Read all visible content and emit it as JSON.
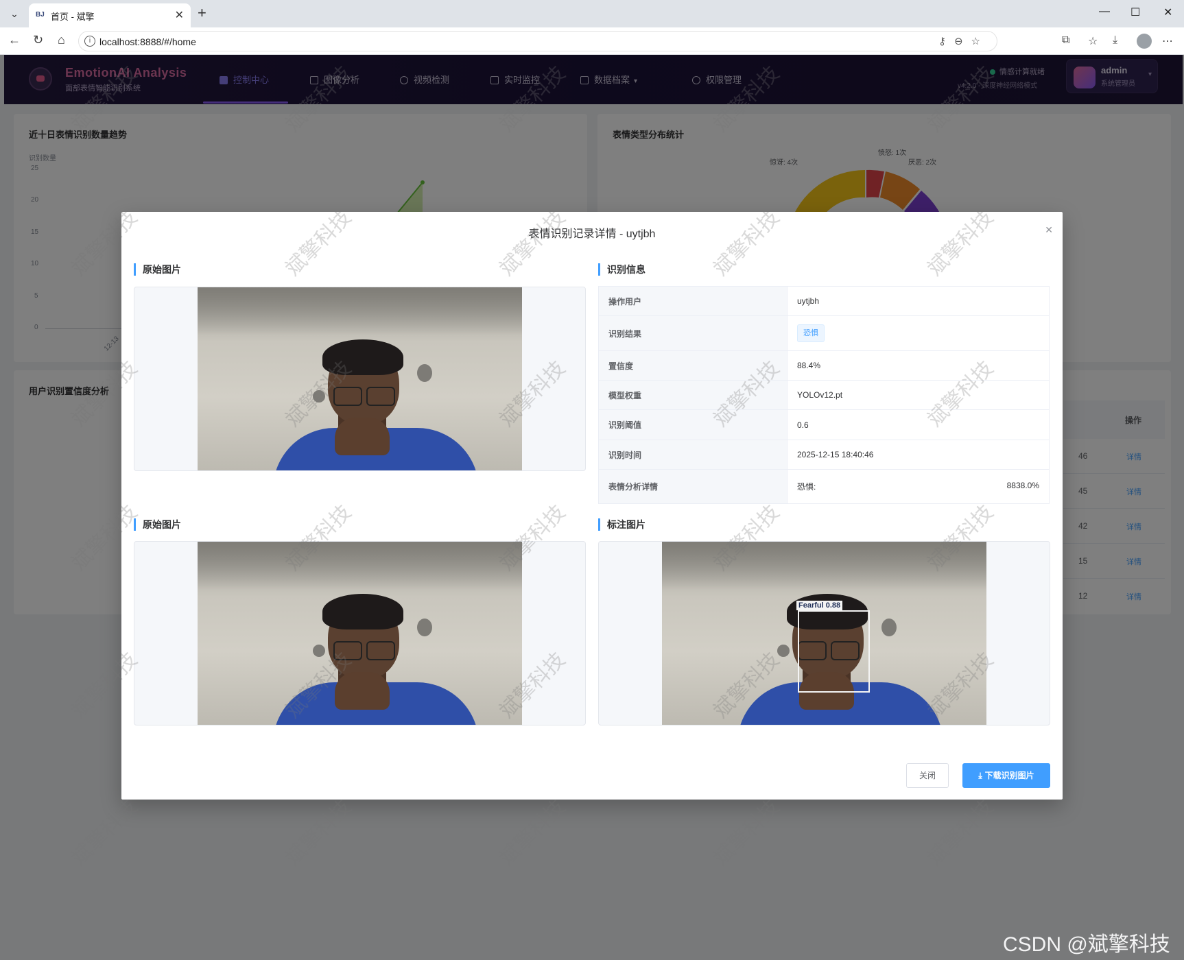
{
  "browser": {
    "tab_title": "首页 - 斌擎",
    "tab_favicon": "BJ",
    "url": "localhost:8888/#/home"
  },
  "app": {
    "brand_name": "EmotionAI Analysis",
    "brand_sub": "面部表情智能识别系统",
    "nav": [
      {
        "label": "控制中心",
        "icon": "home-icon",
        "active": true
      },
      {
        "label": "图像分析",
        "icon": "image-icon"
      },
      {
        "label": "视频检测",
        "icon": "play-circle-icon"
      },
      {
        "label": "实时监控",
        "icon": "camera-icon"
      },
      {
        "label": "数据档案",
        "icon": "document-icon"
      },
      {
        "label": "权限管理",
        "icon": "user-icon"
      }
    ],
    "status_text": "情感计算就绪",
    "status_version": "v4.2.0 - 深度神经网络模式",
    "user_name": "admin",
    "user_role": "系统管理员"
  },
  "dashboard": {
    "trend_title": "近十日表情识别数量趋势",
    "trend_ylabel": "识别数量",
    "trend_yticks": [
      "25",
      "20",
      "15",
      "10",
      "5",
      "0"
    ],
    "trend_xtick": "12-13",
    "pie_title": "表情类型分布统计",
    "pie_labels": [
      "惊讶: 4次",
      "愤怒: 1次",
      "厌恶: 2次"
    ],
    "confidence_title": "用户识别置信度分析",
    "table_header_action": "操作",
    "table_rows": [
      {
        "time_tail": "46",
        "action": "详情"
      },
      {
        "time_tail": "45",
        "action": "详情"
      },
      {
        "time_tail": "42",
        "action": "详情"
      },
      {
        "time_tail": "15",
        "action": "详情"
      },
      {
        "time_tail": "12",
        "action": "详情"
      }
    ]
  },
  "modal": {
    "title": "表情识别记录详情 - uytjbh",
    "section_original": "原始图片",
    "section_info": "识别信息",
    "section_original_2": "原始图片",
    "section_annotated": "标注图片",
    "detection_label": "Fearful  0.88",
    "info": [
      {
        "key": "操作用户",
        "value": "uytjbh"
      },
      {
        "key": "识别结果",
        "value": "恐惧",
        "tag": true
      },
      {
        "key": "置信度",
        "value": "88.4%"
      },
      {
        "key": "模型权重",
        "value": "YOLOv12.pt"
      },
      {
        "key": "识别阈值",
        "value": "0.6"
      },
      {
        "key": "识别时间",
        "value": "2025-12-15 18:40:46"
      },
      {
        "key": "表情分析详情",
        "value": "恐惧:",
        "value_right": "8838.0%"
      }
    ],
    "close_button": "关闭",
    "download_button": "下载识别图片"
  },
  "watermark": "斌擎科技",
  "csdn_watermark": "CSDN @斌擎科技"
}
